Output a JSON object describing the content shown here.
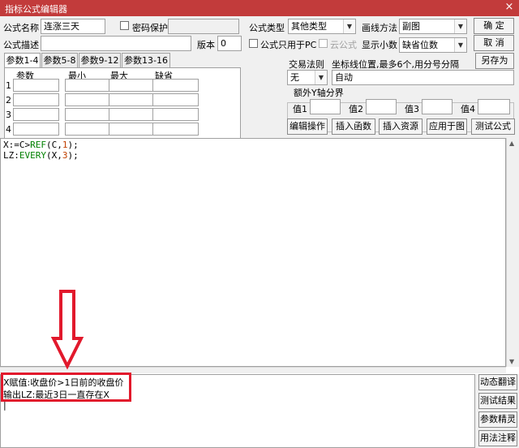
{
  "window": {
    "title": "指标公式编辑器",
    "close_glyph": "×"
  },
  "form": {
    "name_label": "公式名称",
    "name_value": "连涨三天",
    "password_label": "密码保护",
    "type_label": "公式类型",
    "type_value": "其他类型",
    "draw_method_label": "画线方法",
    "draw_method_value": "副图",
    "desc_label": "公式描述",
    "desc_value": "",
    "version_label": "版本",
    "version_value": "0",
    "pc_only_label": "公式只用于PC",
    "cloud_label": "云公式",
    "decimals_label": "显示小数",
    "decimals_value": "缺省位数"
  },
  "buttons": {
    "confirm": "确 定",
    "cancel": "取 消",
    "save_as": "另存为",
    "edit_op": "编辑操作",
    "insert_func": "插入函数",
    "insert_res": "插入资源",
    "apply_chart": "应用于图",
    "test_formula": "测试公式"
  },
  "tabs": [
    "参数1-4",
    "参数5-8",
    "参数9-12",
    "参数13-16"
  ],
  "param_headers": [
    "参数",
    "最小",
    "最大",
    "缺省"
  ],
  "param_rows": [
    "1",
    "2",
    "3",
    "4"
  ],
  "trade_rule": {
    "label": "交易法则",
    "value": "无"
  },
  "axis": {
    "label": "坐标线位置,最多6个,用分号分隔",
    "value": "自动"
  },
  "yaxis": {
    "group_label": "额外Y轴分界",
    "value_labels": [
      "值1",
      "值2",
      "值3",
      "值4"
    ]
  },
  "code": {
    "line1": {
      "a": "X:=C>",
      "fn": "REF",
      "b": "(C,",
      "n": "1",
      "c": ");"
    },
    "line2": {
      "a": "LZ:",
      "fn": "EVERY",
      "b": "(X,",
      "n": "3",
      "c": ");"
    }
  },
  "output": {
    "line1": "X赋值:收盘价>1日前的收盘价",
    "line2": "输出LZ:最近3日一直存在X",
    "cursor": "|"
  },
  "side_buttons": [
    "动态翻译",
    "测试结果",
    "参数精灵",
    "用法注释"
  ],
  "colors": {
    "title_bar": "#c23b3b",
    "annotation_red": "#e2192c",
    "function_green": "#008000"
  }
}
